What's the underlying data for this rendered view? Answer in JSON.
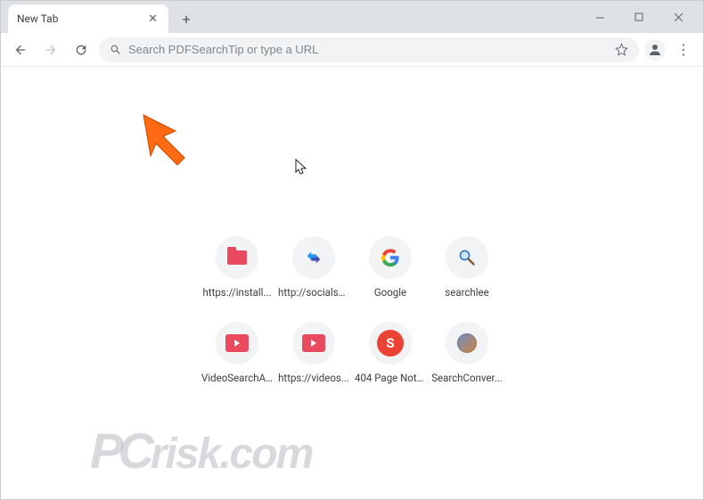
{
  "tabstrip": {
    "active_tab_title": "New Tab"
  },
  "omnibox": {
    "placeholder": "Search PDFSearchTip or type a URL",
    "value": ""
  },
  "shortcuts": [
    {
      "label": "https://install...",
      "icon": "folder"
    },
    {
      "label": "http://socialse...",
      "icon": "arrows"
    },
    {
      "label": "Google",
      "icon": "google"
    },
    {
      "label": "searchlee",
      "icon": "magnify"
    },
    {
      "label": "VideoSearchA...",
      "icon": "video"
    },
    {
      "label": "https://videos...",
      "icon": "video"
    },
    {
      "label": "404 Page Not ...",
      "icon": "s-circle"
    },
    {
      "label": "SearchConver...",
      "icon": "globe"
    }
  ],
  "watermark": "PCrisk.com"
}
